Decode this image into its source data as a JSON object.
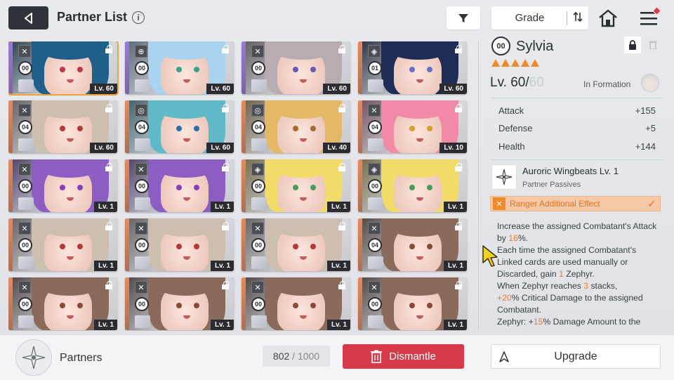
{
  "header": {
    "title": "Partner List",
    "info": "i",
    "grade_label": "Grade"
  },
  "icons": [
    "back-arrow-icon",
    "info-icon",
    "filter-icon",
    "sort-icon",
    "home-icon",
    "menu-icon",
    "lock-icon",
    "trash-icon"
  ],
  "cards": [
    {
      "grade": "00",
      "level": "Lv. 60",
      "stripe": "#9a7ad6",
      "hair": "#1f5f8a",
      "eye": "#c2334a",
      "type": "✕",
      "selected": true
    },
    {
      "grade": "00",
      "level": "Lv. 60",
      "stripe": "#9a7ad6",
      "hair": "#a9d3ee",
      "eye": "#3aa38b",
      "type": "⊕",
      "selected": false
    },
    {
      "grade": "00",
      "level": "Lv. 60",
      "stripe": "#9a7ad6",
      "hair": "#b7adb0",
      "eye": "#6a57b8",
      "type": "✕",
      "selected": false
    },
    {
      "grade": "01",
      "level": "Lv. 60",
      "stripe": "#e8895a",
      "hair": "#1f2c56",
      "eye": "#6a6fc8",
      "type": "◈",
      "selected": false
    },
    {
      "grade": "04",
      "level": "Lv. 60",
      "stripe": "#e8895a",
      "hair": "#cdbfb0",
      "eye": "#b33a3a",
      "type": "✕",
      "selected": false
    },
    {
      "grade": "04",
      "level": "Lv. 60",
      "stripe": "#e8895a",
      "hair": "#5fb9c7",
      "eye": "#2f6fa8",
      "type": "◎",
      "selected": false
    },
    {
      "grade": "04",
      "level": "Lv. 40",
      "stripe": "#e8895a",
      "hair": "#e4b864",
      "eye": "#a86a2c",
      "type": "◎",
      "selected": false
    },
    {
      "grade": "04",
      "level": "Lv. 10",
      "stripe": "#e8895a",
      "hair": "#f08aa6",
      "eye": "#d1a12a",
      "type": "✕",
      "selected": false
    },
    {
      "grade": "00",
      "level": "Lv. 1",
      "stripe": "#e8895a",
      "hair": "#8c5ec4",
      "eye": "#8a3fb8",
      "type": "✕",
      "selected": false
    },
    {
      "grade": "00",
      "level": "Lv. 1",
      "stripe": "#e8895a",
      "hair": "#8c5ec4",
      "eye": "#8a3fb8",
      "type": "✕",
      "selected": false
    },
    {
      "grade": "00",
      "level": "Lv. 1",
      "stripe": "#e8895a",
      "hair": "#f3db6a",
      "eye": "#4a9a5a",
      "type": "◈",
      "selected": false
    },
    {
      "grade": "00",
      "level": "Lv. 1",
      "stripe": "#e8895a",
      "hair": "#f3db6a",
      "eye": "#4a9a5a",
      "type": "◈",
      "selected": false
    },
    {
      "grade": "00",
      "level": "Lv. 1",
      "stripe": "#e8895a",
      "hair": "#cdbfb0",
      "eye": "#b33a3a",
      "type": "✕",
      "selected": false
    },
    {
      "grade": "00",
      "level": "Lv. 1",
      "stripe": "#e8895a",
      "hair": "#cdbfb0",
      "eye": "#b33a3a",
      "type": "✕",
      "selected": false
    },
    {
      "grade": "00",
      "level": "Lv. 1",
      "stripe": "#e8895a",
      "hair": "#cdbfb0",
      "eye": "#b33a3a",
      "type": "✕",
      "selected": false
    },
    {
      "grade": "04",
      "level": "Lv. 1",
      "stripe": "#e8895a",
      "hair": "#8a6a5a",
      "eye": "#8a4a3a",
      "type": "✕",
      "selected": false
    },
    {
      "grade": "00",
      "level": "Lv. 1",
      "stripe": "#e8895a",
      "hair": "#8a6a5a",
      "eye": "#8a4a3a",
      "type": "✕",
      "selected": false
    },
    {
      "grade": "00",
      "level": "Lv. 1",
      "stripe": "#e8895a",
      "hair": "#8a6a5a",
      "eye": "#8a4a3a",
      "type": "✕",
      "selected": false
    },
    {
      "grade": "00",
      "level": "Lv. 1",
      "stripe": "#e8895a",
      "hair": "#8a6a5a",
      "eye": "#8a4a3a",
      "type": "✕",
      "selected": false
    },
    {
      "grade": "00",
      "level": "Lv. 1",
      "stripe": "#e8895a",
      "hair": "#8a6a5a",
      "eye": "#8a4a3a",
      "type": "✕",
      "selected": false
    }
  ],
  "detail": {
    "grade": "00",
    "name": "Sylvia",
    "stars": 5,
    "level": "Lv. 60",
    "level_sep": "/",
    "level_max": "60",
    "formation_label": "In Formation",
    "stats": [
      {
        "label": "Attack",
        "value": "+155"
      },
      {
        "label": "Defense",
        "value": "+5"
      },
      {
        "label": "Health",
        "value": "+144"
      }
    ],
    "passive_name": "Auroric Wingbeats Lv. 1",
    "passive_sub": "Partner Passives",
    "ranger_text": "Ranger Additional Effect",
    "ranger_check": "✓",
    "desc": {
      "p1": "Increase the assigned Combatant's Attack by ",
      "p1_val": "16",
      "p1_end": "%.",
      "p2": "Each time the assigned Combatant's Linked cards are used manually or Discarded, gain ",
      "p2_val": "1",
      "p2_end": " Zephyr.",
      "p3": "When Zephyr reaches ",
      "p3_val": "3",
      "p3_end": " stacks,",
      "p4_val": "+20",
      "p4_end": "% Critical Damage to the assigned Combatant.",
      "p5": "Zephyr: +",
      "p5_val": "15",
      "p5_end": "% Damage Amount to the"
    }
  },
  "bottom": {
    "label": "Partners",
    "count": "802",
    "sep": "/",
    "capacity": "1000",
    "dismantle": "Dismantle",
    "upgrade": "Upgrade"
  },
  "colors": {
    "accent": "#f08a2b",
    "dismantle": "#d6394a",
    "selected_outline": "#f0a43a"
  }
}
